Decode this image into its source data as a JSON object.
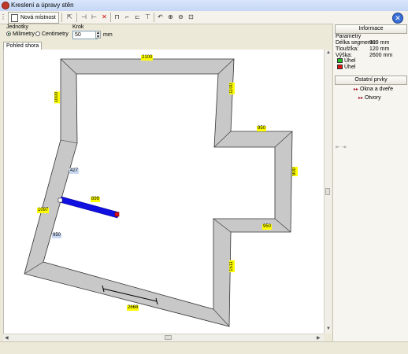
{
  "window": {
    "title": "Kreslení a úpravy stěn"
  },
  "toolbar": {
    "new_room_label": "Nová místnost"
  },
  "settings": {
    "units_label": "Jednotky",
    "unit_mm": "Milimetry",
    "unit_cm": "Centimetry",
    "selected_unit": "Milimetry",
    "step_label": "Krok",
    "step_value": "50",
    "step_unit": "mm"
  },
  "tabs": [
    {
      "label": "Pohled shora",
      "active": true
    }
  ],
  "plan": {
    "dimensions": {
      "top": "2100",
      "left_upper": "1000",
      "right_upper": "1100",
      "step_top": "950",
      "right_outer": "900",
      "step_bottom": "950",
      "right_lower": "1511",
      "bottom": "2668",
      "left_lower": "1097",
      "selected_length": "899",
      "marker_a": "427",
      "marker_b": "950"
    }
  },
  "info_panel": {
    "header": "Informace",
    "params_label": "Parametry",
    "segment_length_label": "Délka segmentu:",
    "segment_length_value": "899 mm",
    "thickness_label": "Tloušťka:",
    "thickness_value": "120 mm",
    "height_label": "Výška:",
    "height_value": "2600 mm",
    "angle1_label": "Úhel",
    "angle2_label": "Úhel",
    "angle1_color": "#1fbf1f",
    "angle2_color": "#e01010"
  },
  "other_panel": {
    "header": "Ostatní prvky",
    "windows_doors_label": "Okna a dveře",
    "openings_label": "Otvory"
  },
  "colors": {
    "wall_fill": "#c8c8c8",
    "selected_wall": "#1010e0",
    "dim_label": "#ffff00"
  }
}
